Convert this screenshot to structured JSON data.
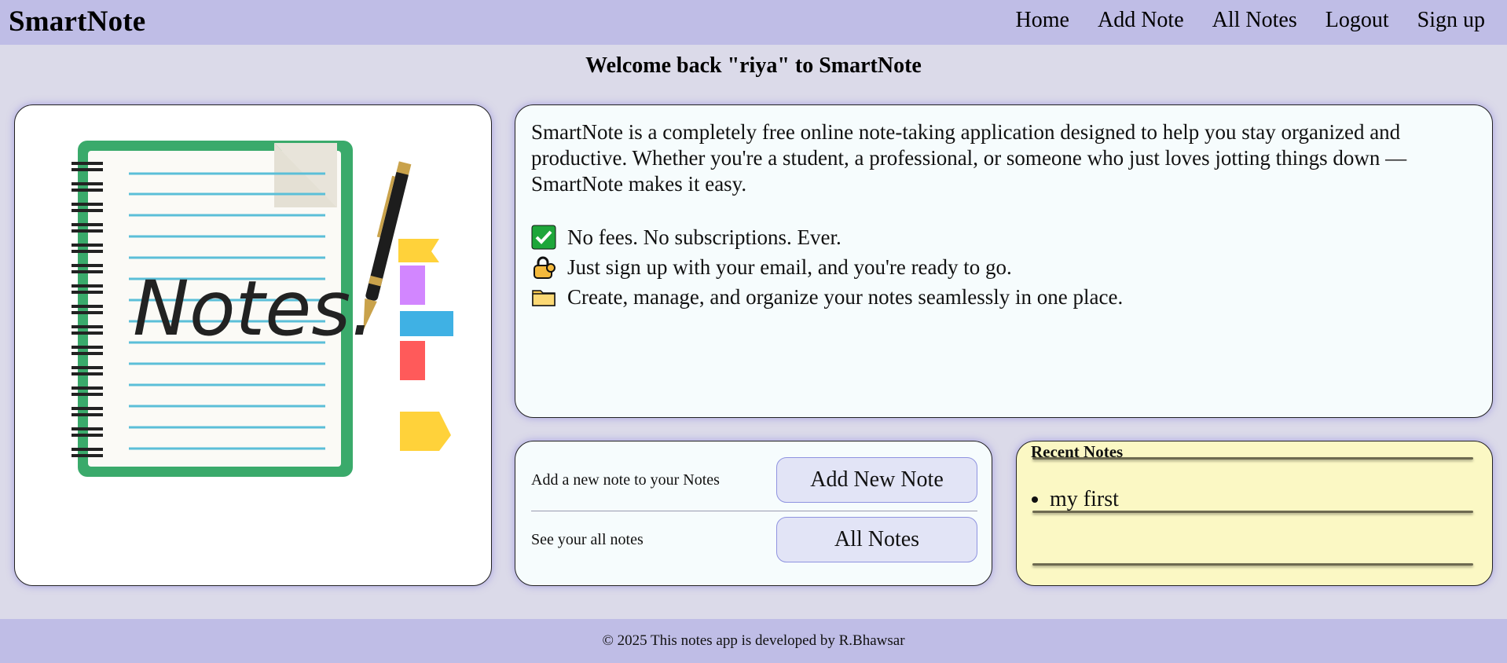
{
  "nav": {
    "brand": "SmartNote",
    "links": [
      "Home",
      "Add Note",
      "All Notes",
      "Logout",
      "Sign up"
    ]
  },
  "welcome": "Welcome back \"riya\" to SmartNote",
  "hero_image": {
    "icon": "notebook-illustration",
    "text": "Notes."
  },
  "info": {
    "description": "SmartNote is a completely free online note-taking application designed to help you stay organized and productive. Whether you're a student, a professional, or someone who just loves jotting things down — SmartNote makes it easy.",
    "features": [
      {
        "icon": "check-icon",
        "text": "No fees. No subscriptions. Ever."
      },
      {
        "icon": "lock-icon",
        "text": "Just sign up with your email, and you're ready to go."
      },
      {
        "icon": "folder-icon",
        "text": "Create, manage, and organize your notes seamlessly in one place."
      }
    ]
  },
  "actions": {
    "add_label": "Add a new note to your Notes",
    "add_button": "Add New Note",
    "all_label": "See your all notes",
    "all_button": "All Notes"
  },
  "recent": {
    "title": "Recent Notes",
    "items": [
      "my first"
    ]
  },
  "footer": "© 2025 This notes app is developed by R.Bhawsar",
  "colors": {
    "nav_bg": "#bfbde6",
    "page_bg": "#dbdae9",
    "card_bg": "#f6fcfd",
    "recent_bg": "#fbf8c4",
    "button_bg": "#e2e4f6",
    "notebook_green": "#3aaa6b",
    "notebook_lines": "#5bbfd8"
  }
}
